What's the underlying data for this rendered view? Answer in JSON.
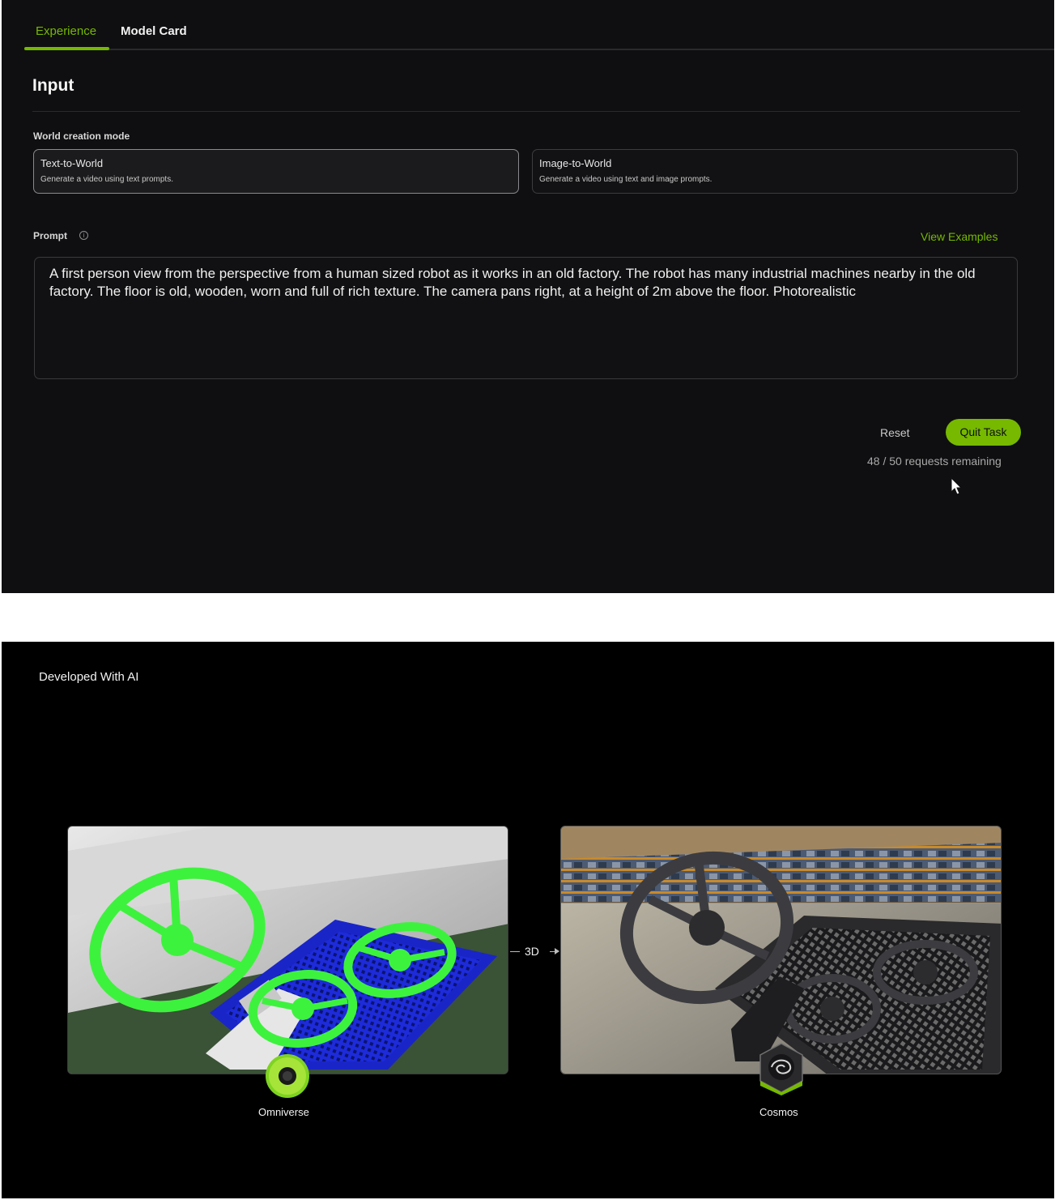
{
  "tabs": [
    {
      "label": "Experience",
      "active": true
    },
    {
      "label": "Model Card",
      "active": false
    }
  ],
  "input": {
    "title": "Input",
    "mode_label": "World creation mode",
    "modes": [
      {
        "title": "Text-to-World",
        "desc": "Generate a video using text prompts.",
        "selected": true
      },
      {
        "title": "Image-to-World",
        "desc": "Generate a video using text and image prompts.",
        "selected": false
      }
    ],
    "prompt_label": "Prompt",
    "view_examples": "View Examples",
    "prompt_text": "A first person view from the perspective from a human sized robot as it works in an old factory.  The robot has many industrial machines nearby in the old factory.  The floor is old, wooden, worn and full of rich texture.  The camera pans right, at a height of 2m above the floor. Photorealistic",
    "reset_label": "Reset",
    "quit_label": "Quit Task",
    "requests_remaining": "48 / 50 requests remaining"
  },
  "showcase": {
    "title": "Developed With AI",
    "arrow_label": "3D",
    "left_label": "Omniverse",
    "right_label": "Cosmos"
  },
  "colors": {
    "accent": "#76b900",
    "panel_bg": "#0f0f11",
    "bottom_bg": "#000000"
  }
}
